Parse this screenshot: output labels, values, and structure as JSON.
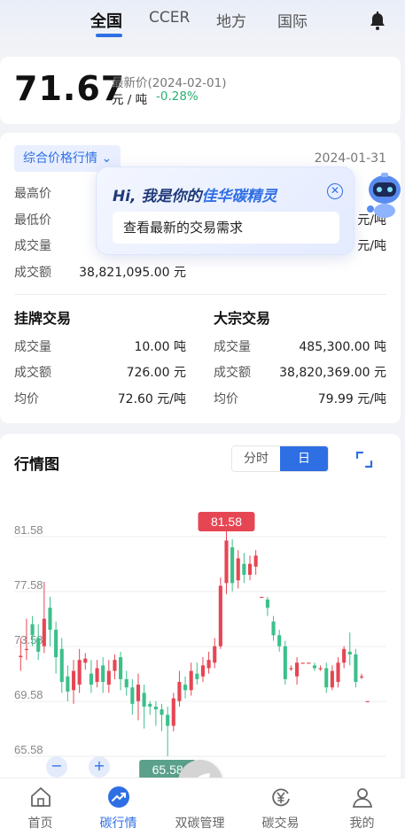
{
  "tabs": [
    "全国",
    "CCER",
    "地方",
    "国际"
  ],
  "price": {
    "value": "71.67",
    "latest_label": "最新价(2024-02-01)",
    "unit": "元 / 吨",
    "change": "-0.28%",
    "change_color": "#2bb173"
  },
  "summary": {
    "dropdown_label": "综合价格行情",
    "date": "2024-01-31",
    "rows": [
      {
        "label": "最高价",
        "value": "",
        "right_value": "元"
      },
      {
        "label": "最低价",
        "value": "",
        "right_value": "元/吨"
      },
      {
        "label": "成交量",
        "value": "",
        "right_value": "元/吨"
      },
      {
        "label": "成交额",
        "value": "38,821,095.00 元",
        "right_value": ""
      }
    ],
    "listing": {
      "title": "挂牌交易",
      "rows": [
        {
          "label": "成交量",
          "value": "10.00 吨"
        },
        {
          "label": "成交额",
          "value": "726.00 元"
        },
        {
          "label": "均价",
          "value": "72.60 元/吨"
        }
      ]
    },
    "bulk": {
      "title": "大宗交易",
      "rows": [
        {
          "label": "成交量",
          "value": "485,300.00 吨"
        },
        {
          "label": "成交额",
          "value": "38,820,369.00 元"
        },
        {
          "label": "均价",
          "value": "79.99 元/吨"
        }
      ]
    }
  },
  "popup": {
    "title_prefix": "Hi, 我是你的",
    "title_highlight": "佳华碳精灵",
    "close_symbol": "✕",
    "input_text": "查看最新的交易需求"
  },
  "chart": {
    "title": "行情图",
    "seg_minute": "分时",
    "seg_day": "日",
    "max_label": "81.58",
    "min_label": "65.58",
    "zoom_out": "−",
    "zoom_in": "+",
    "up_color": "#e64654",
    "down_color": "#3cc08b"
  },
  "chart_data": {
    "type": "candlestick",
    "y_ticks": [
      "81.58",
      "77.58",
      "73.58",
      "69.58",
      "65.58"
    ],
    "ylim": [
      65.58,
      81.58
    ],
    "candles": [
      {
        "o": 72.8,
        "c": 72.9,
        "h": 74.2,
        "l": 71.8
      },
      {
        "o": 73.4,
        "c": 73.4,
        "h": 75.6,
        "l": 72.6
      },
      {
        "o": 75.2,
        "c": 74.4,
        "h": 75.8,
        "l": 73.6
      },
      {
        "o": 74.2,
        "c": 73.2,
        "h": 75.2,
        "l": 72.6
      },
      {
        "o": 73.6,
        "c": 75.6,
        "h": 78.3,
        "l": 73.1
      },
      {
        "o": 76.4,
        "c": 74.8,
        "h": 77.2,
        "l": 73.6
      },
      {
        "o": 74.8,
        "c": 72.8,
        "h": 75.4,
        "l": 71.6
      },
      {
        "o": 73.4,
        "c": 71.0,
        "h": 74.2,
        "l": 70.2
      },
      {
        "o": 71.4,
        "c": 70.3,
        "h": 72.2,
        "l": 69.6
      },
      {
        "o": 70.4,
        "c": 71.8,
        "h": 72.6,
        "l": 69.4
      },
      {
        "o": 70.8,
        "c": 72.6,
        "h": 73.4,
        "l": 70.2
      },
      {
        "o": 72.4,
        "c": 72.7,
        "h": 73.1,
        "l": 71.9
      },
      {
        "o": 71.6,
        "c": 70.8,
        "h": 72.6,
        "l": 70.2
      },
      {
        "o": 71.0,
        "c": 72.0,
        "h": 72.6,
        "l": 70.6
      },
      {
        "o": 72.2,
        "c": 71.0,
        "h": 72.8,
        "l": 70.2
      },
      {
        "o": 70.8,
        "c": 71.8,
        "h": 72.6,
        "l": 70.2
      },
      {
        "o": 71.8,
        "c": 72.6,
        "h": 73.0,
        "l": 71.2
      },
      {
        "o": 72.8,
        "c": 71.2,
        "h": 73.2,
        "l": 70.4
      },
      {
        "o": 71.2,
        "c": 70.6,
        "h": 71.8,
        "l": 70.0
      },
      {
        "o": 70.6,
        "c": 69.4,
        "h": 71.2,
        "l": 68.6
      },
      {
        "o": 69.6,
        "c": 70.8,
        "h": 71.6,
        "l": 68.2
      },
      {
        "o": 70.2,
        "c": 69.2,
        "h": 70.8,
        "l": 67.6
      },
      {
        "o": 69.4,
        "c": 69.2,
        "h": 69.6,
        "l": 68.6
      },
      {
        "o": 69.2,
        "c": 69.0,
        "h": 69.6,
        "l": 67.8
      },
      {
        "o": 69.0,
        "c": 68.6,
        "h": 69.4,
        "l": 67.4
      },
      {
        "o": 68.6,
        "c": 67.8,
        "h": 69.2,
        "l": 65.58
      },
      {
        "o": 67.8,
        "c": 69.8,
        "h": 70.2,
        "l": 67.4
      },
      {
        "o": 69.6,
        "c": 71.0,
        "h": 71.8,
        "l": 69.2
      },
      {
        "o": 70.8,
        "c": 70.4,
        "h": 71.4,
        "l": 69.8
      },
      {
        "o": 70.4,
        "c": 71.8,
        "h": 72.4,
        "l": 70.0
      },
      {
        "o": 71.6,
        "c": 71.2,
        "h": 72.4,
        "l": 70.8
      },
      {
        "o": 71.4,
        "c": 72.2,
        "h": 72.8,
        "l": 71.0
      },
      {
        "o": 72.0,
        "c": 72.6,
        "h": 73.2,
        "l": 71.6
      },
      {
        "o": 72.4,
        "c": 73.6,
        "h": 74.2,
        "l": 72.0
      },
      {
        "o": 73.6,
        "c": 78.0,
        "h": 78.6,
        "l": 73.4
      },
      {
        "o": 78.2,
        "c": 81.3,
        "h": 81.58,
        "l": 77.4
      },
      {
        "o": 80.8,
        "c": 78.2,
        "h": 81.4,
        "l": 77.6
      },
      {
        "o": 78.4,
        "c": 80.0,
        "h": 80.6,
        "l": 77.8
      },
      {
        "o": 79.6,
        "c": 78.8,
        "h": 80.4,
        "l": 78.2
      },
      {
        "o": 78.8,
        "c": 79.6,
        "h": 80.2,
        "l": 78.4
      },
      {
        "o": 79.4,
        "c": 80.2,
        "h": 80.6,
        "l": 78.8
      },
      {
        "o": 77.2,
        "c": 77.2,
        "h": 77.2,
        "l": 77.2
      },
      {
        "o": 77.0,
        "c": 76.4,
        "h": 77.2,
        "l": 75.8
      },
      {
        "o": 75.4,
        "c": 74.4,
        "h": 75.8,
        "l": 74.0
      },
      {
        "o": 74.4,
        "c": 73.6,
        "h": 74.8,
        "l": 73.2
      },
      {
        "o": 73.6,
        "c": 71.2,
        "h": 74.0,
        "l": 70.8
      },
      {
        "o": 72.0,
        "c": 72.0,
        "h": 72.2,
        "l": 71.8
      },
      {
        "o": 71.4,
        "c": 72.4,
        "h": 72.8,
        "l": 70.8
      },
      {
        "o": 72.4,
        "c": 72.4,
        "h": 72.4,
        "l": 72.4
      },
      {
        "o": 72.4,
        "c": 72.4,
        "h": 72.4,
        "l": 72.4
      },
      {
        "o": 72.2,
        "c": 72.0,
        "h": 72.4,
        "l": 71.8
      },
      {
        "o": 72.0,
        "c": 72.0,
        "h": 72.2,
        "l": 71.8
      },
      {
        "o": 72.0,
        "c": 70.6,
        "h": 72.4,
        "l": 70.2
      },
      {
        "o": 70.6,
        "c": 71.8,
        "h": 72.2,
        "l": 70.4
      },
      {
        "o": 71.0,
        "c": 72.4,
        "h": 72.8,
        "l": 70.6
      },
      {
        "o": 72.4,
        "c": 73.4,
        "h": 73.6,
        "l": 72.0
      },
      {
        "o": 73.2,
        "c": 73.0,
        "h": 74.6,
        "l": 72.2
      },
      {
        "o": 73.0,
        "c": 71.0,
        "h": 73.4,
        "l": 70.6
      },
      {
        "o": 71.4,
        "c": 71.4,
        "h": 71.6,
        "l": 71.2
      },
      {
        "o": 69.6,
        "c": 69.6,
        "h": 69.6,
        "l": 69.6
      }
    ]
  },
  "nav": [
    {
      "label": "首页",
      "icon": "home-icon"
    },
    {
      "label": "碳行情",
      "icon": "trend-icon",
      "active": true
    },
    {
      "label": "双碳管理",
      "icon": "leaf-icon"
    },
    {
      "label": "碳交易",
      "icon": "yen-cycle-icon"
    },
    {
      "label": "我的",
      "icon": "user-icon"
    }
  ]
}
